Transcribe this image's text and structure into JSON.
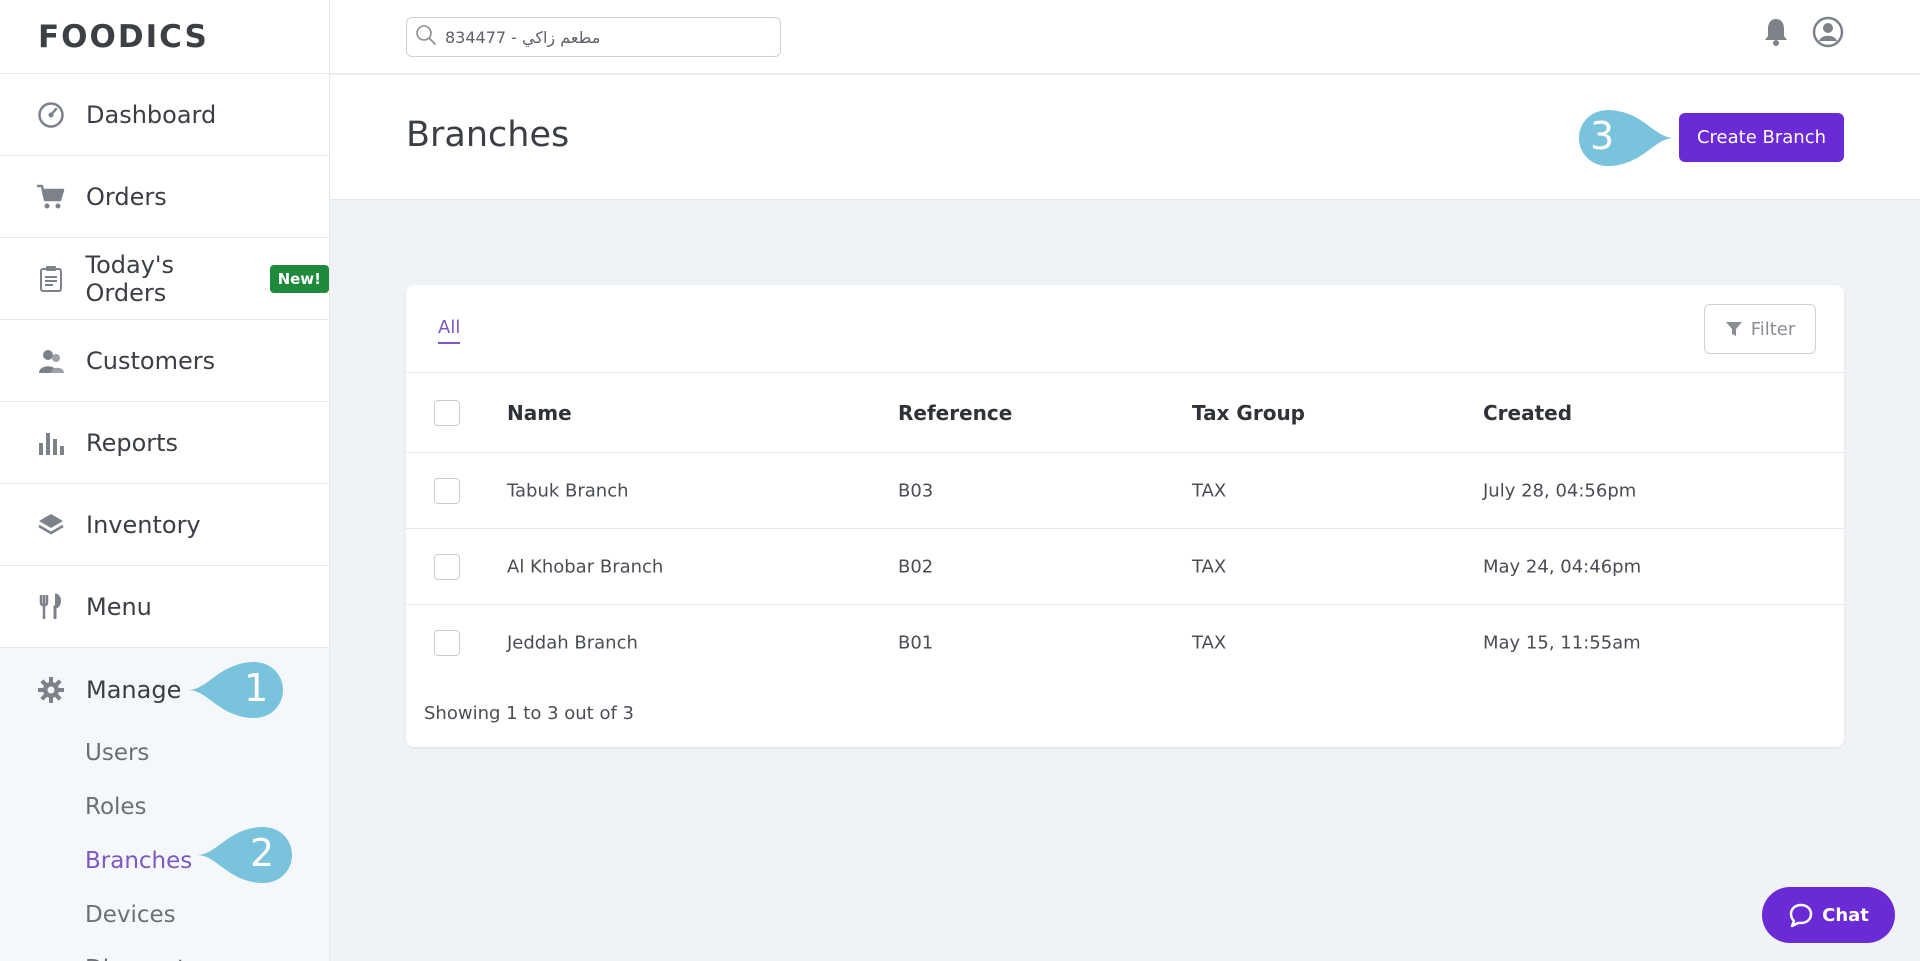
{
  "app": {
    "logo": "FOODICS"
  },
  "sidebar": {
    "items": [
      {
        "label": "Dashboard"
      },
      {
        "label": "Orders"
      },
      {
        "label": "Today's Orders",
        "badge": "New!"
      },
      {
        "label": "Customers"
      },
      {
        "label": "Reports"
      },
      {
        "label": "Inventory"
      },
      {
        "label": "Menu"
      }
    ],
    "manage": {
      "label": "Manage",
      "sub_items": [
        {
          "label": "Users"
        },
        {
          "label": "Roles"
        },
        {
          "label": "Branches",
          "active": true
        },
        {
          "label": "Devices"
        },
        {
          "label": "Discounts"
        }
      ]
    }
  },
  "topbar": {
    "search_value": "مطعم زاكي - 834477"
  },
  "header": {
    "title": "Branches",
    "create_label": "Create Branch"
  },
  "table": {
    "tab_all": "All",
    "filter_label": "Filter",
    "columns": [
      "Name",
      "Reference",
      "Tax Group",
      "Created"
    ],
    "rows": [
      {
        "name": "Tabuk Branch",
        "reference": "B03",
        "tax_group": "TAX",
        "created": "July 28, 04:56pm"
      },
      {
        "name": "Al Khobar Branch",
        "reference": "B02",
        "tax_group": "TAX",
        "created": "May 24, 04:46pm"
      },
      {
        "name": "Jeddah Branch",
        "reference": "B01",
        "tax_group": "TAX",
        "created": "May 15, 11:55am"
      }
    ],
    "showing": "Showing 1 to 3 out of 3"
  },
  "callouts": [
    "1",
    "2",
    "3"
  ],
  "chat": {
    "label": "Chat"
  },
  "colors": {
    "accent": "#6a2ad6",
    "active_link": "#7e57c2",
    "callout": "#79c3dc",
    "badge": "#1f8a3b"
  }
}
